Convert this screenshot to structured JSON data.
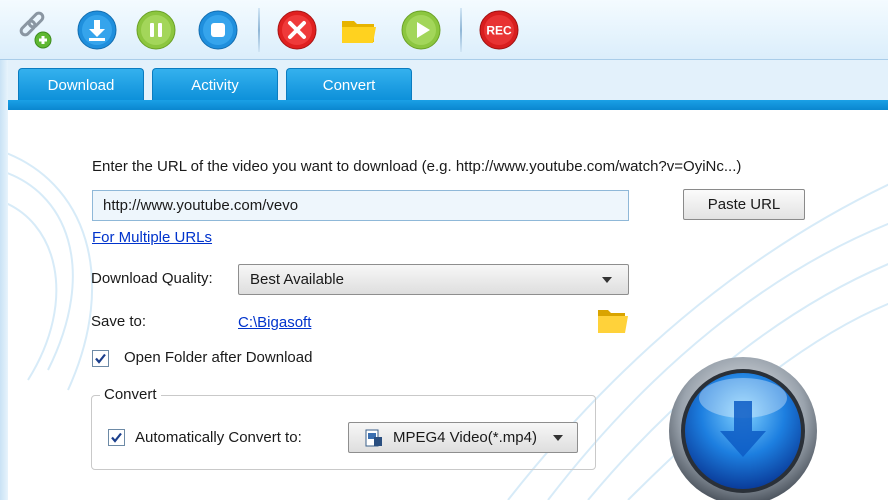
{
  "toolbar": {
    "buttons": [
      {
        "name": "add-url",
        "icon": "link-add-icon"
      },
      {
        "name": "download",
        "icon": "download-icon"
      },
      {
        "name": "pause",
        "icon": "pause-icon"
      },
      {
        "name": "stop",
        "icon": "stop-icon"
      },
      {
        "name": "delete",
        "icon": "delete-icon"
      },
      {
        "name": "open-folder",
        "icon": "folder-icon"
      },
      {
        "name": "play",
        "icon": "play-icon"
      },
      {
        "name": "record",
        "icon": "rec-icon",
        "label": "REC"
      }
    ]
  },
  "tabs": [
    {
      "label": "Download"
    },
    {
      "label": "Activity"
    },
    {
      "label": "Convert"
    }
  ],
  "download": {
    "url_prompt": "Enter the URL of the video you want to download (e.g. http://www.youtube.com/watch?v=OyiNc...)",
    "url_value": "http://www.youtube.com/vevo",
    "paste_url_label": "Paste URL",
    "multiple_urls_link": "For Multiple URLs",
    "quality_label": "Download Quality:",
    "quality_value": "Best Available",
    "save_to_label": "Save to:",
    "save_to_path": "C:\\Bigasoft",
    "open_folder_label": "Open Folder after Download",
    "open_folder_checked": true,
    "convert_group_title": "Convert",
    "auto_convert_label": "Automatically Convert to:",
    "auto_convert_checked": true,
    "format_value": "MPEG4 Video(*.mp4)"
  },
  "colors": {
    "tab_blue": "#0b8ed8",
    "link_blue": "#0033cc",
    "download_blue": "#1f8fdd",
    "pause_green": "#8cc63f",
    "delete_red": "#e02020",
    "rec_red": "#d81e1e"
  }
}
